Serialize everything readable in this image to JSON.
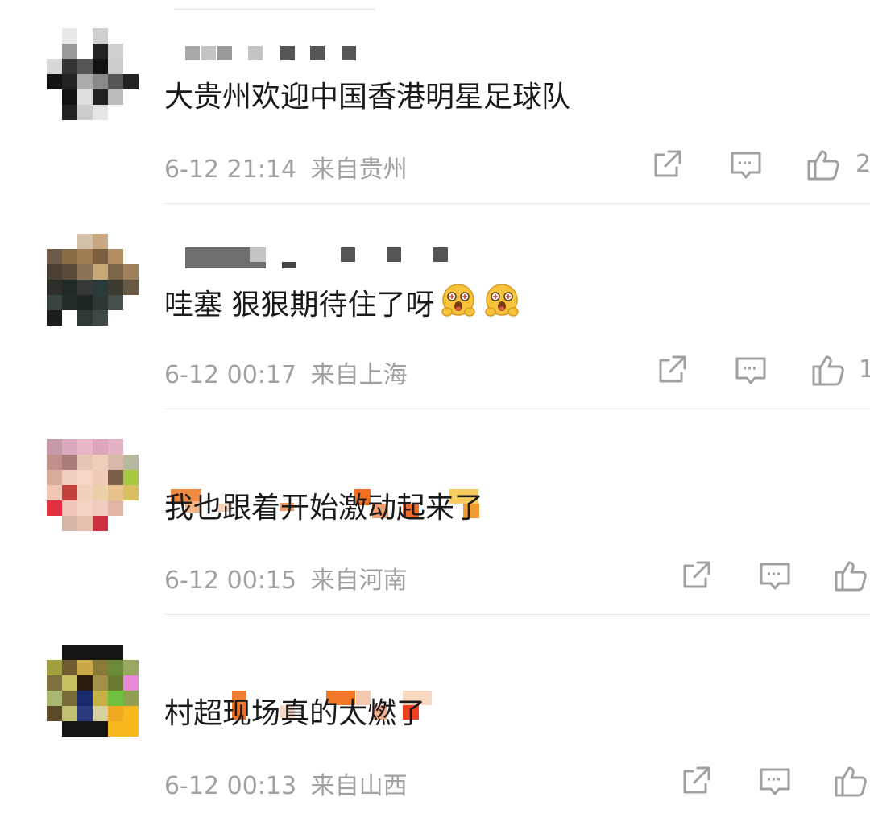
{
  "colors": {
    "text": "#1a1a1a",
    "meta": "#a0a0a0",
    "divider": "#e6e6e6"
  },
  "comments": [
    {
      "content": "大贵州欢迎中国香港明星足球队",
      "timestamp": "6-12 21:14",
      "location": "来自贵州",
      "likes": "2",
      "emojis": []
    },
    {
      "content": "哇塞 狠狠期待住了呀",
      "timestamp": "6-12 00:17",
      "location": "来自上海",
      "likes": "1",
      "emojis": [
        "drooling-emoji",
        "drooling-emoji"
      ]
    },
    {
      "content": "我也跟着开始激动起来了",
      "timestamp": "6-12 00:15",
      "location": "来自河南",
      "likes": "",
      "emojis": []
    },
    {
      "content": "村超现场真的太燃了",
      "timestamp": "6-12 00:13",
      "location": "来自山西",
      "likes": "",
      "emojis": []
    }
  ],
  "icons": {
    "share": "share-icon",
    "reply": "comment-icon",
    "like": "thumbs-up-icon"
  }
}
